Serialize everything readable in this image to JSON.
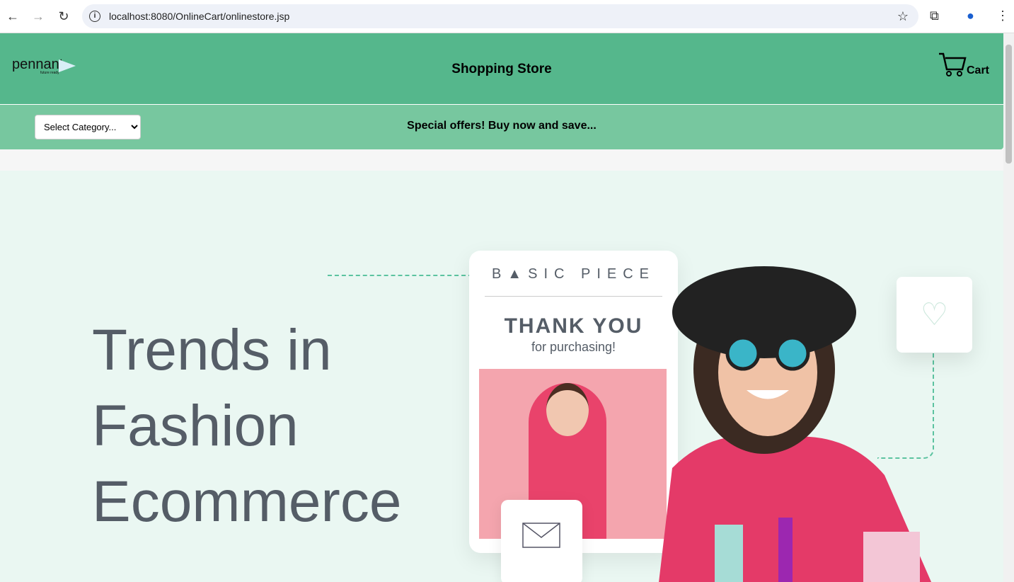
{
  "browser": {
    "url": "localhost:8080/OnlineCart/onlinestore.jsp"
  },
  "header": {
    "logo": "pennant",
    "logo_tagline": "future ready",
    "title": "Shopping Store",
    "cart_label": "Cart"
  },
  "toolbar": {
    "category_select": "Select Category...",
    "offer": "Special offers! Buy now and save..."
  },
  "hero": {
    "line1": "Trends in",
    "line2": "Fashion",
    "line3": "Ecommerce",
    "card_brand": "B▲SIC PIECE",
    "card_title": "THANK YOU",
    "card_subtitle": "for purchasing!"
  },
  "colors": {
    "header": "#55b78c",
    "bar": "#77c79f",
    "hero_bg": "#eaf7f2"
  }
}
